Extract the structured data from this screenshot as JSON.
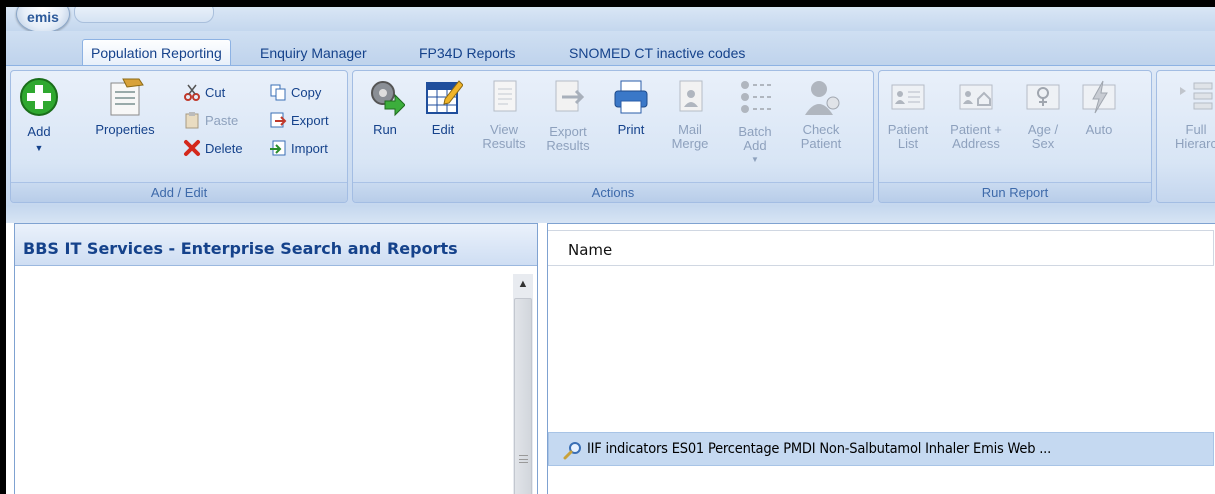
{
  "app": {
    "logo_text": "emis"
  },
  "tabs": [
    {
      "label": "Population Reporting",
      "active": true
    },
    {
      "label": "Enquiry Manager",
      "active": false
    },
    {
      "label": "FP34D Reports",
      "active": false
    },
    {
      "label": "SNOMED CT inactive codes",
      "active": false
    }
  ],
  "ribbon": {
    "add_edit": {
      "group_label": "Add / Edit",
      "add": "Add",
      "properties": "Properties",
      "cut": "Cut",
      "paste": "Paste",
      "delete": "Delete",
      "copy": "Copy",
      "export": "Export",
      "import": "Import"
    },
    "actions": {
      "group_label": "Actions",
      "run": "Run",
      "edit": "Edit",
      "view_results_1": "View",
      "view_results_2": "Results",
      "export_results_1": "Export",
      "export_results_2": "Results",
      "print": "Print",
      "mail_merge_1": "Mail",
      "mail_merge_2": "Merge",
      "batch_add_1": "Batch",
      "batch_add_2": "Add",
      "check_patient_1": "Check",
      "check_patient_2": "Patient"
    },
    "run_report": {
      "group_label": "Run Report",
      "patient_list_1": "Patient",
      "patient_list_2": "List",
      "patient_address_1": "Patient +",
      "patient_address_2": "Address",
      "age_sex_1": "Age /",
      "age_sex_2": "Sex",
      "auto": "Auto"
    },
    "partial": {
      "full_hierarchy_1": "Full",
      "full_hierarchy_2": "Hierarc"
    }
  },
  "left_panel": {
    "title": "BBS IT Services - Enterprise Search and Reports"
  },
  "right_panel": {
    "column_name": "Name",
    "rows": [
      {
        "label": "IIF indicators ES01 Percentage PMDI Non-Salbutamol Inhaler Emis Web ..."
      }
    ]
  }
}
